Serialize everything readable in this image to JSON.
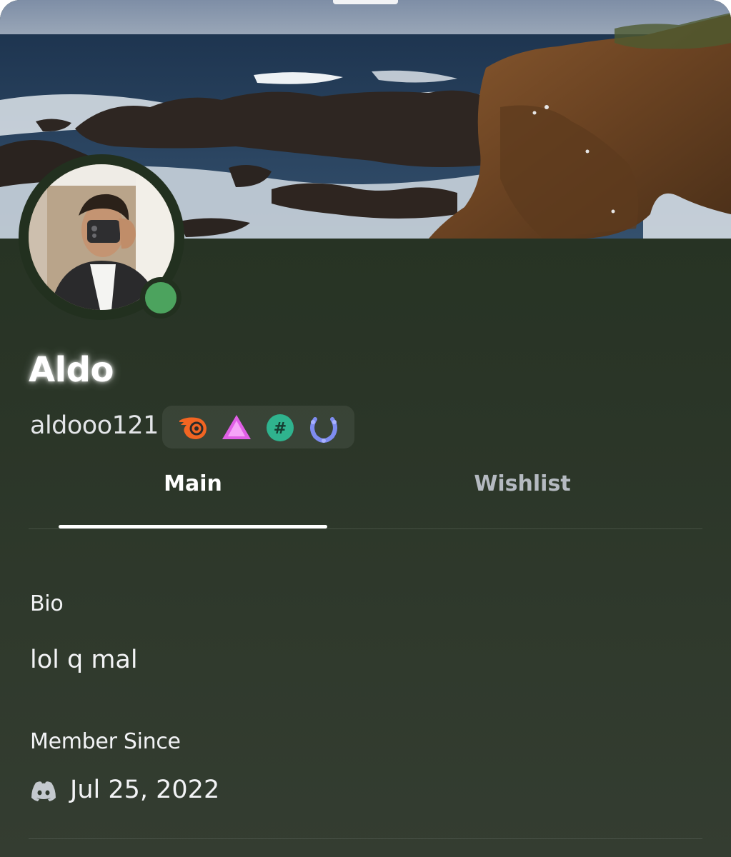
{
  "profile": {
    "display_name": "Aldo",
    "username": "aldooo121",
    "status": "online",
    "status_color": "#4ca35e"
  },
  "badges": [
    {
      "icon": "hypesquad-flame-icon"
    },
    {
      "icon": "triangle-badge-icon"
    },
    {
      "icon": "hashtag-badge-icon"
    },
    {
      "icon": "laurel-badge-icon"
    }
  ],
  "tabs": {
    "main": "Main",
    "wishlist": "Wishlist",
    "active": "main"
  },
  "bio": {
    "heading": "Bio",
    "text": "lol q mal"
  },
  "member_since": {
    "heading": "Member Since",
    "icon": "discord-logo-icon",
    "date": "Jul 25, 2022"
  },
  "theme": {
    "background_top": "#22301f",
    "background_bottom": "#343d31"
  }
}
